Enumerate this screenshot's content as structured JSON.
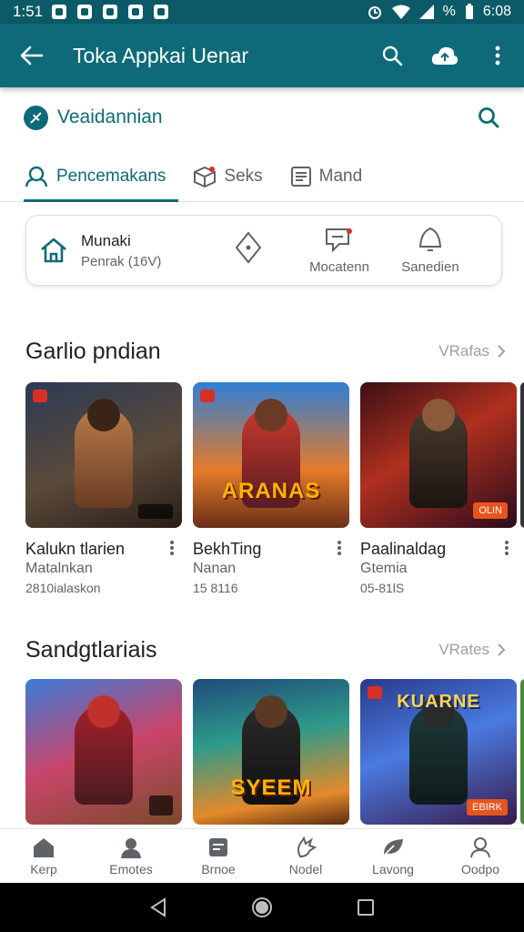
{
  "status_bar": {
    "time": "1:51",
    "battery_text": "%",
    "clock_right": "6:08"
  },
  "app_bar": {
    "title": "Toka Appkai Uenar"
  },
  "brand": {
    "name": "Veaidannian"
  },
  "tabs": [
    {
      "label": "Pencemakans"
    },
    {
      "label": "Seks"
    },
    {
      "label": "Mand"
    }
  ],
  "quick_card": {
    "home_title": "Munaki",
    "home_subtitle": "Penrak (16V)",
    "items": [
      {
        "label": ""
      },
      {
        "label": "Mocatenn"
      },
      {
        "label": "Sanedien"
      }
    ]
  },
  "sections": [
    {
      "title": "Garlio pndian",
      "more_label": "VRafas",
      "cards": [
        {
          "name": "Kalukn tlarien",
          "sub": "Matalnkan",
          "meta": "2810ialaskon",
          "tag": "",
          "banner": ""
        },
        {
          "name": "BekhTing",
          "sub": "Nanan",
          "meta": "15 8116",
          "tag": "",
          "banner": "ARANAS"
        },
        {
          "name": "Paalinaldag",
          "sub": "Gtemia",
          "meta": "05-81lS",
          "tag": "OLIN",
          "banner": ""
        }
      ]
    },
    {
      "title": "Sandgtlariais",
      "more_label": "VRates",
      "cards": [
        {
          "name": "",
          "sub": "",
          "meta": "",
          "tag": "",
          "banner": ""
        },
        {
          "name": "",
          "sub": "",
          "meta": "",
          "tag": "",
          "banner": "SYEEM"
        },
        {
          "name": "",
          "sub": "",
          "meta": "",
          "tag": "EBIRK",
          "banner": "KUARNE"
        }
      ]
    }
  ],
  "bottom_nav": [
    {
      "label": "Kerp",
      "icon": "home-icon"
    },
    {
      "label": "Emotes",
      "icon": "person-icon"
    },
    {
      "label": "Brnoe",
      "icon": "book-icon"
    },
    {
      "label": "Nodel",
      "icon": "hand-icon"
    },
    {
      "label": "Lavong",
      "icon": "leaf-icon"
    },
    {
      "label": "Oodpo",
      "icon": "account-icon"
    }
  ],
  "colors": {
    "primary": "#0e6a78",
    "status_bar": "#0c5a68",
    "text": "#202124",
    "muted": "#5f6368"
  }
}
